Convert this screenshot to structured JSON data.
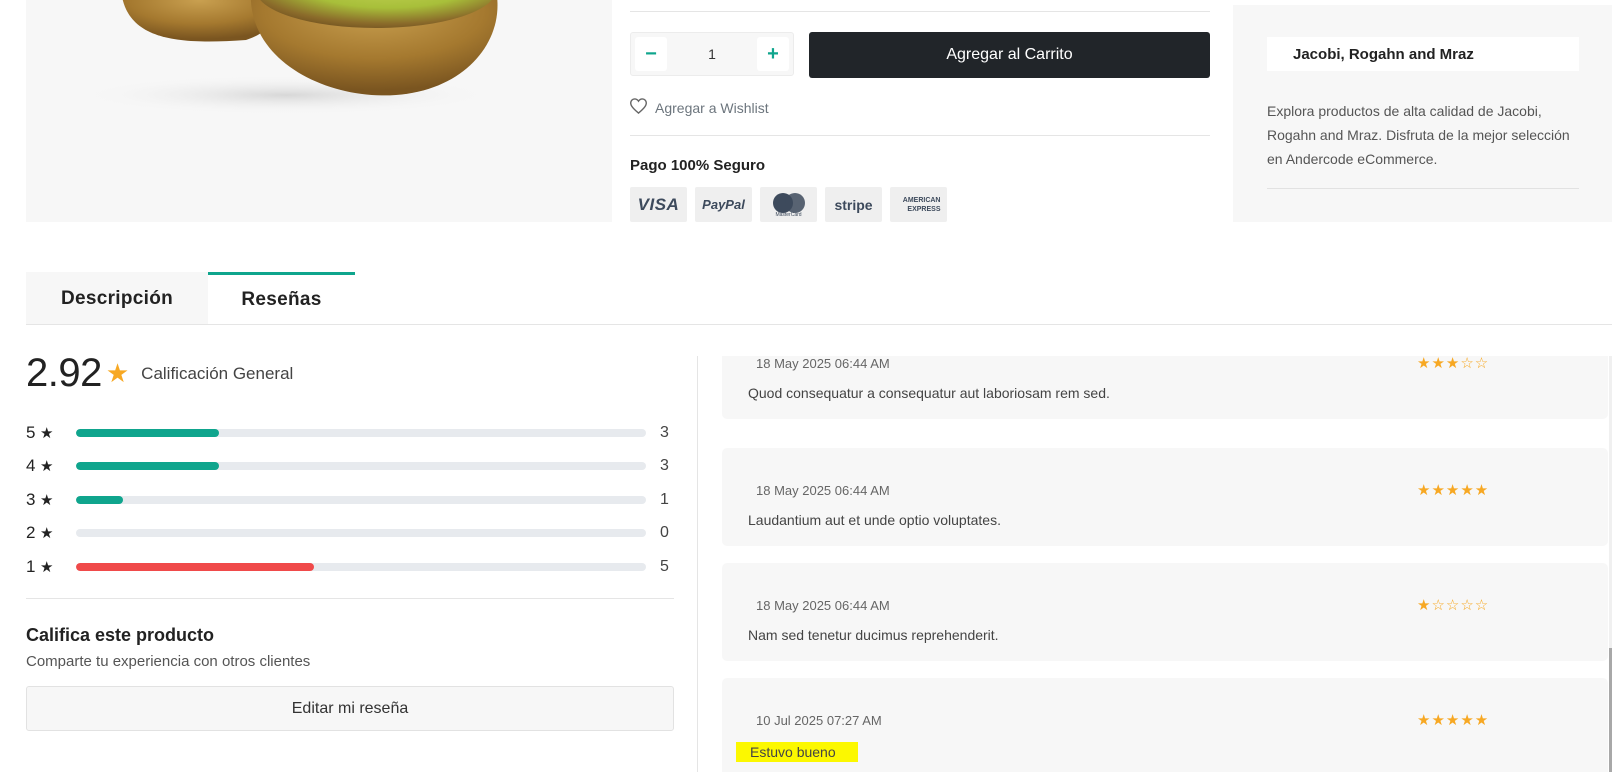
{
  "purchase": {
    "quantity": "1",
    "minus_symbol": "−",
    "plus_symbol": "+",
    "add_to_cart_label": "Agregar al Carrito",
    "wishlist_label": "Agregar a Wishlist",
    "payment_title": "Pago 100% Seguro",
    "payment_methods": [
      "VISA",
      "PayPal",
      "MasterCard",
      "stripe",
      "AMERICAN EXPRESS"
    ]
  },
  "brand": {
    "name": "Jacobi, Rogahn and Mraz",
    "description": "Explora productos de alta calidad de Jacobi, Rogahn and Mraz. Disfruta de la mejor selección en Andercode eCommerce."
  },
  "tabs": [
    {
      "label": "Descripción",
      "active": false
    },
    {
      "label": "Reseñas",
      "active": true
    }
  ],
  "rating_summary": {
    "average": "2.92",
    "label": "Calificación General",
    "distribution": [
      {
        "stars": "5",
        "count": "3",
        "fraction": 0.25,
        "color": "#0fa58d"
      },
      {
        "stars": "4",
        "count": "3",
        "fraction": 0.25,
        "color": "#0fa58d"
      },
      {
        "stars": "3",
        "count": "1",
        "fraction": 0.083,
        "color": "#0fa58d"
      },
      {
        "stars": "2",
        "count": "0",
        "fraction": 0,
        "color": "#0fa58d"
      },
      {
        "stars": "1",
        "count": "5",
        "fraction": 0.417,
        "color": "#f04a4a"
      }
    ],
    "rate_title": "Califica este producto",
    "rate_subtitle": "Comparte tu experiencia con otros clientes",
    "edit_button": "Editar mi reseña"
  },
  "reviews": [
    {
      "date": "18 May 2025 06:44 AM",
      "text": "Quod consequatur a consequatur aut laboriosam rem sed.",
      "rating": 3,
      "highlighted": false
    },
    {
      "date": "18 May 2025 06:44 AM",
      "text": "Laudantium aut et unde optio voluptates.",
      "rating": 5,
      "highlighted": false
    },
    {
      "date": "18 May 2025 06:44 AM",
      "text": "Nam sed tenetur ducimus reprehenderit.",
      "rating": 1,
      "highlighted": false
    },
    {
      "date": "10 Jul 2025 07:27 AM",
      "text": "Estuvo bueno",
      "rating": 5,
      "highlighted": true
    }
  ],
  "colors": {
    "accent": "#0fa58d",
    "star": "#f7a823",
    "danger": "#f04a4a",
    "dark_button": "#212529",
    "highlight": "#fcf800"
  }
}
